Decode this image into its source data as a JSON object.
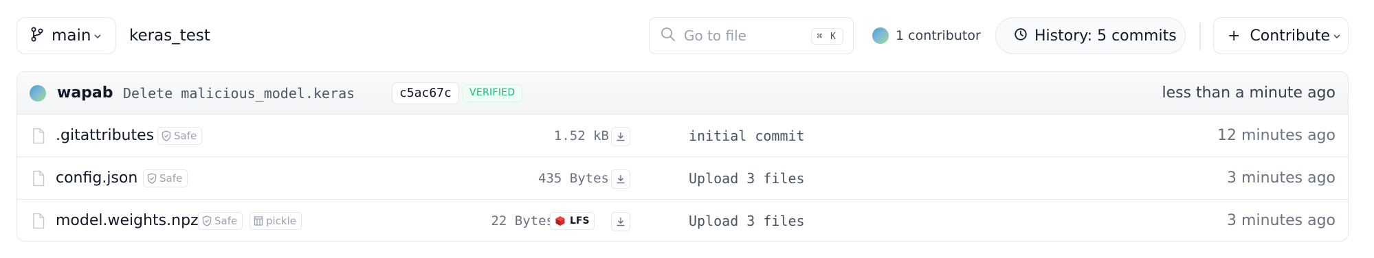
{
  "toolbar": {
    "branch_label": "main",
    "repo_name": "keras_test",
    "search_placeholder": "Go to file",
    "search_shortcut": "⌘ K",
    "contributors_label": "1 contributor",
    "history_label": "History: 5 commits",
    "contribute_label": "Contribute",
    "contribute_plus": "+"
  },
  "last_commit": {
    "author": "wapab",
    "message": "Delete malicious_model.keras",
    "sha": "c5ac67c",
    "verified_label": "VERIFIED",
    "time": "less than a minute ago"
  },
  "files": [
    {
      "name": ".gitattributes",
      "safe_label": "Safe",
      "size": "1.52 kB",
      "commit_message": "initial commit",
      "time": "12 minutes ago"
    },
    {
      "name": "config.json",
      "safe_label": "Safe",
      "size": "435 Bytes",
      "commit_message": "Upload 3 files",
      "time": "3 minutes ago"
    },
    {
      "name": "model.weights.npz",
      "safe_label": "Safe",
      "extra_badge": "pickle",
      "size": "22 Bytes",
      "lfs_label": "LFS",
      "commit_message": "Upload 3 files",
      "time": "3 minutes ago"
    }
  ],
  "icons": {
    "branch": "git-branch-icon",
    "search": "search-icon",
    "history": "clock-icon",
    "file": "file-icon",
    "safe": "shield-icon",
    "download": "download-icon",
    "lfs": "lfs-cube-icon"
  },
  "colors": {
    "verified": "#10b981",
    "lfs": "#dc2626",
    "border": "#e5e7eb"
  }
}
